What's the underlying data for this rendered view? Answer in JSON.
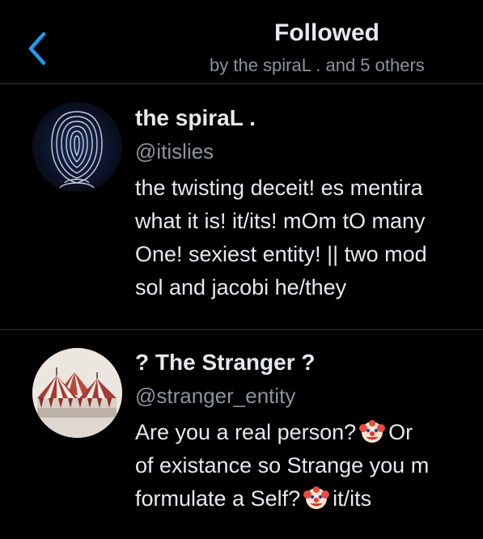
{
  "header": {
    "back_icon": "chevron-left-icon",
    "title": "Followed",
    "subtitle": "by the spiraL . and 5 others"
  },
  "colors": {
    "background": "#000000",
    "primary_text": "#e7e9ea",
    "secondary_text": "#8b949b",
    "accent": "#1d9bf0",
    "divider": "#2f3336"
  },
  "users": [
    {
      "display_name": "the spiraL .",
      "handle": "@itislies",
      "avatar_icon": "spiral-face-avatar",
      "bio_lines": [
        "the twisting deceit! es mentira",
        "what it is! it/its! mOm tO many",
        "One! sexiest entity! || two mod",
        "sol and jacobi he/they"
      ]
    },
    {
      "display_name": "? The Stranger ?",
      "handle": "@stranger_entity",
      "avatar_icon": "circus-tent-avatar",
      "bio_line_1_before": "Are you a real person?",
      "bio_line_1_after": "Or",
      "bio_line_2": "of existance so Strange you m",
      "bio_line_3_before": "formulate a Self?",
      "bio_line_3_after": "it/its",
      "emoji_icon": "clown-face-icon"
    }
  ]
}
